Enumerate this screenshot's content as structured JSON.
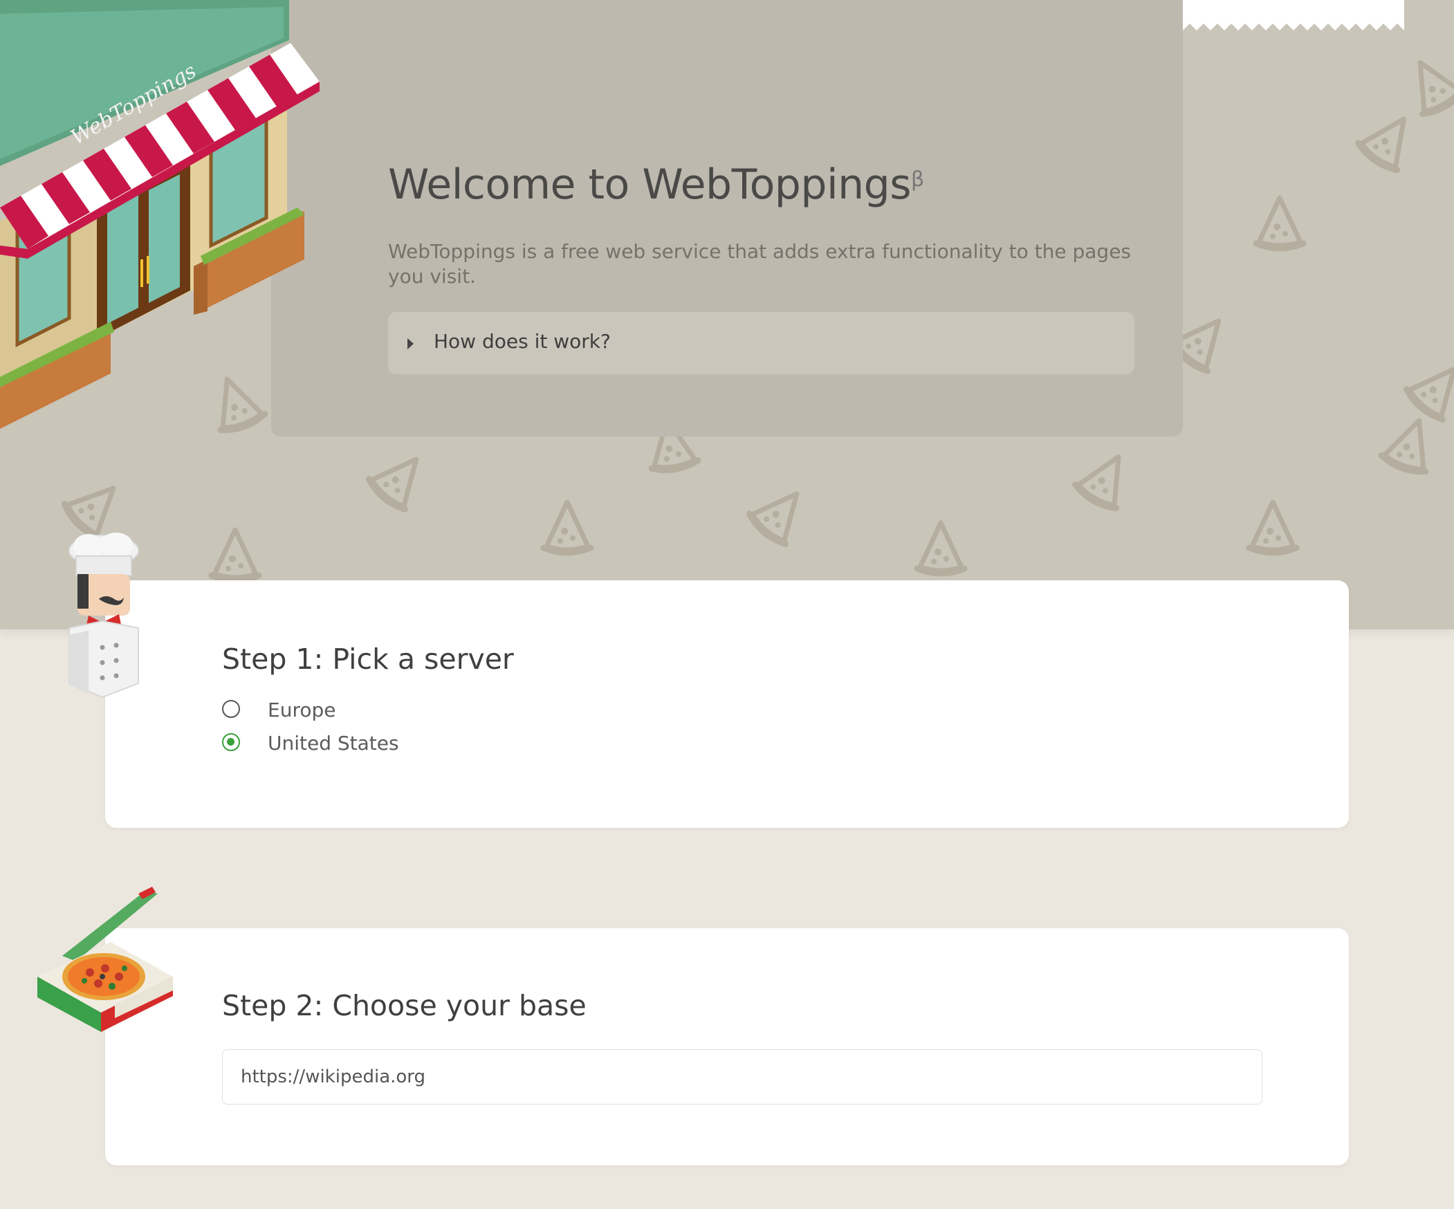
{
  "hero": {
    "title": "Welcome to WebToppings",
    "title_sup": "β",
    "description": "WebToppings is a free web service that adds extra functionality to the pages you visit.",
    "accordion_label": "How does it work?",
    "shop_sign": "WebToppings"
  },
  "step1": {
    "title": "Step 1: Pick a server",
    "options": [
      {
        "label": "Europe",
        "selected": false
      },
      {
        "label": "United States",
        "selected": true
      }
    ]
  },
  "step2": {
    "title": "Step 2: Choose your base",
    "url_value": "https://wikipedia.org"
  },
  "colors": {
    "accent": "#3aa03a",
    "hero_bg": "#cac5b9",
    "page_bg": "#ebe7df",
    "awning_red": "#c8184a",
    "shop_green": "#5fa383"
  },
  "icons": [
    "pizza-slice-icon",
    "shop-illustration",
    "chef-illustration",
    "pizza-box-illustration",
    "caret-right-icon"
  ]
}
